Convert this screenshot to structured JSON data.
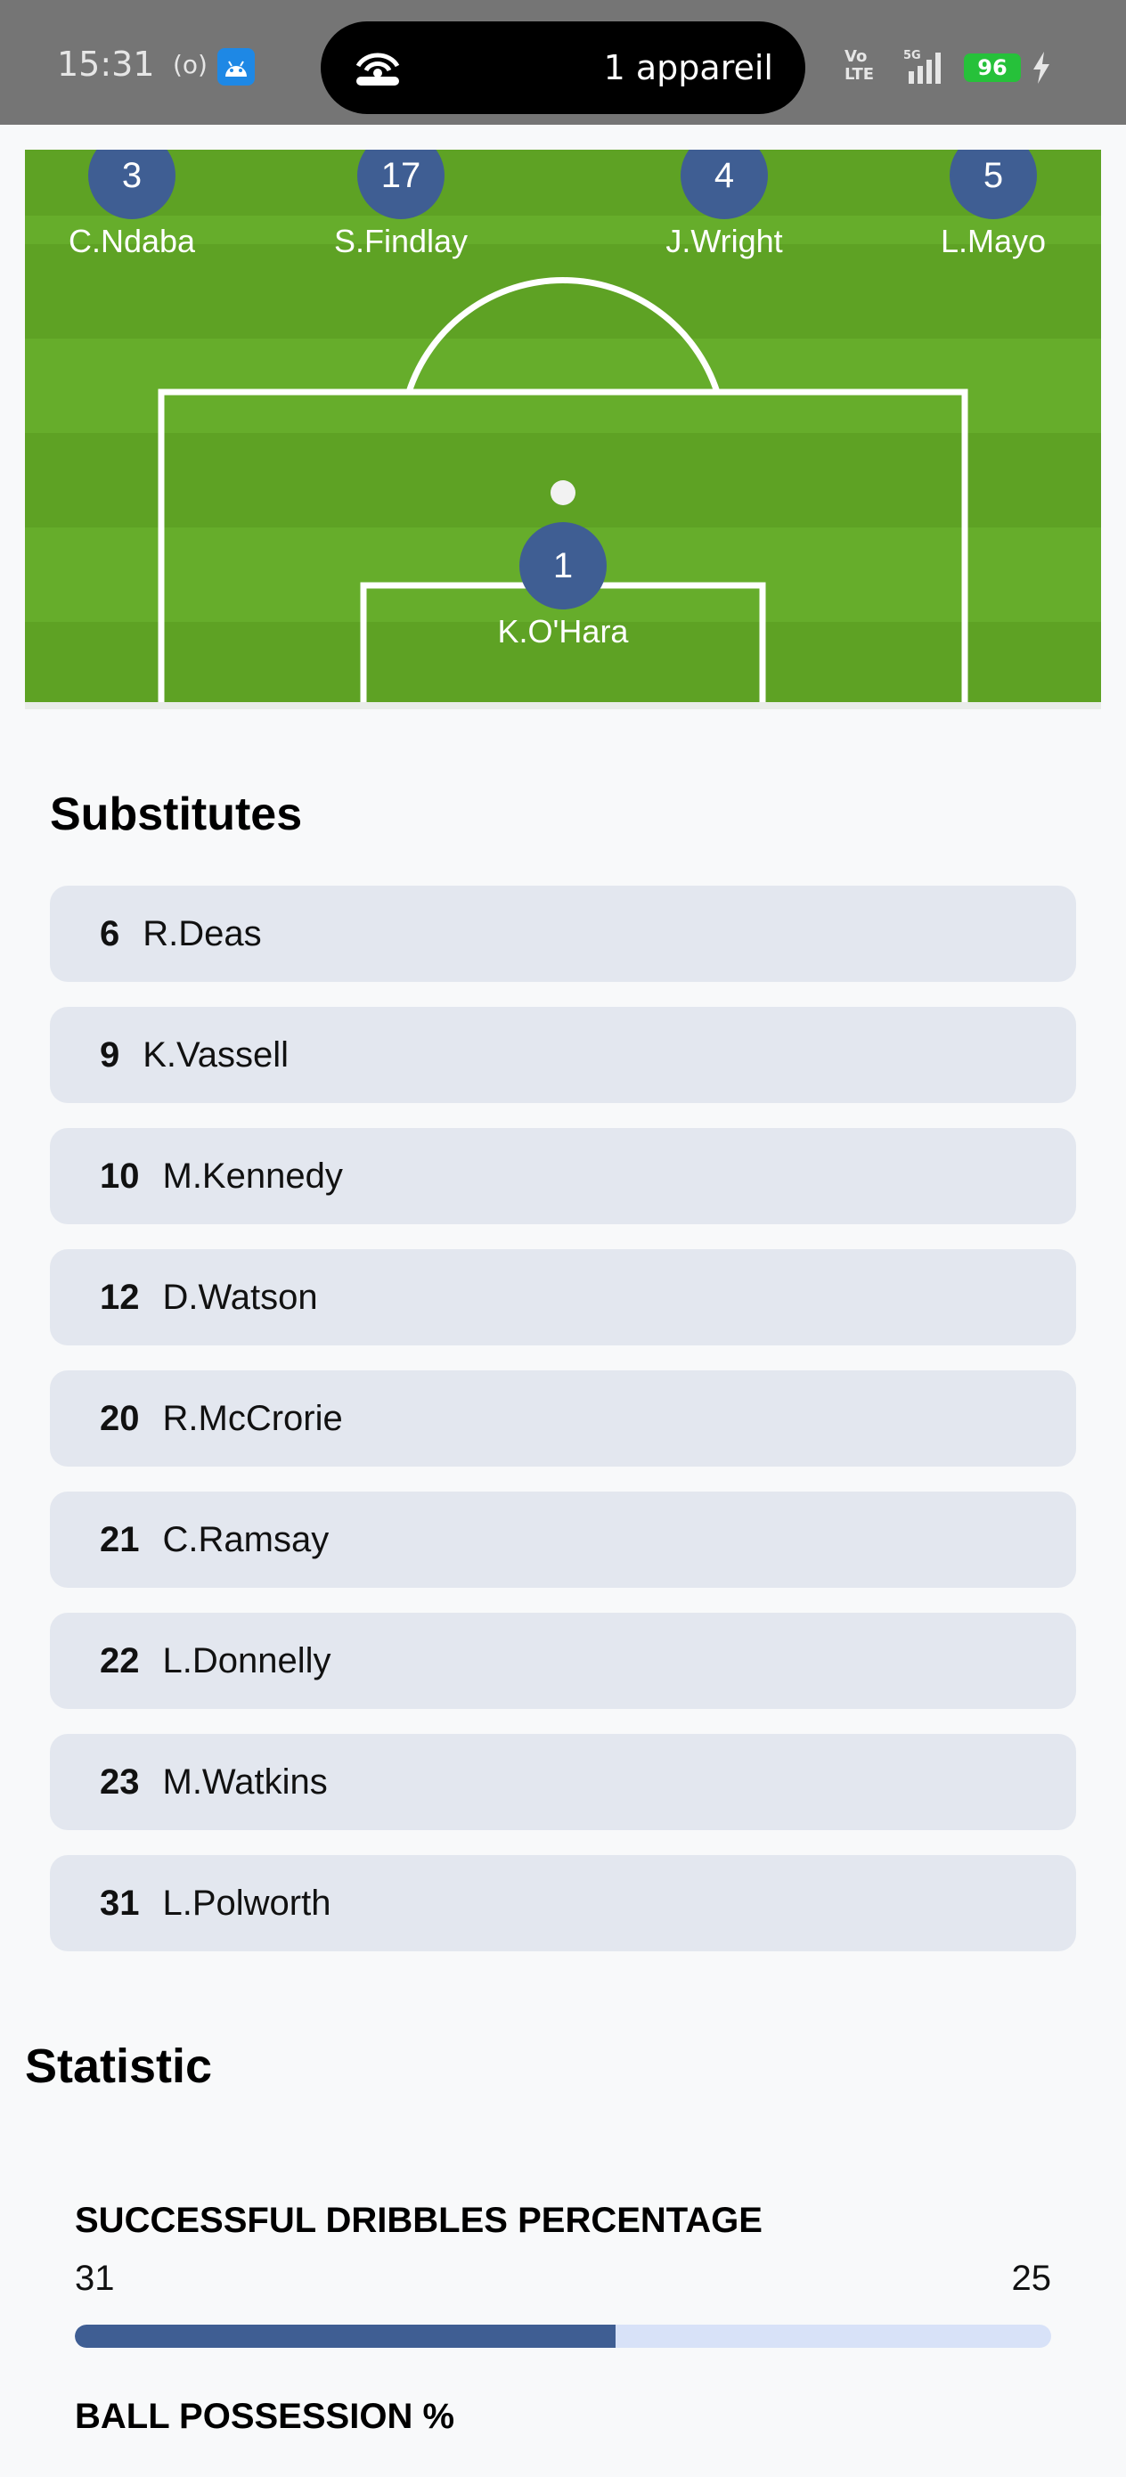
{
  "status_bar": {
    "time": "15:31",
    "radio_glyph": "(o)",
    "hotspot_text": "1 appareil",
    "network_top": "Vo",
    "network_bottom": "LTE",
    "battery": "96",
    "icons": [
      "radio-icon",
      "android-icon",
      "hotspot-icon",
      "signal-5g-icon",
      "battery-icon",
      "charging-bolt-icon"
    ]
  },
  "pitch": {
    "players_top": [
      {
        "number": "3",
        "name": "C.Ndaba"
      },
      {
        "number": "17",
        "name": "S.Findlay"
      },
      {
        "number": "4",
        "name": "J.Wright"
      },
      {
        "number": "5",
        "name": "L.Mayo"
      }
    ],
    "goalkeeper": {
      "number": "1",
      "name": "K.O'Hara"
    }
  },
  "substitutes": {
    "title": "Substitutes",
    "items": [
      {
        "number": "6",
        "name": "R.Deas"
      },
      {
        "number": "9",
        "name": "K.Vassell"
      },
      {
        "number": "10",
        "name": "M.Kennedy"
      },
      {
        "number": "12",
        "name": "D.Watson"
      },
      {
        "number": "20",
        "name": "R.McCrorie"
      },
      {
        "number": "21",
        "name": "C.Ramsay"
      },
      {
        "number": "22",
        "name": "L.Donnelly"
      },
      {
        "number": "23",
        "name": "M.Watkins"
      },
      {
        "number": "31",
        "name": "L.Polworth"
      }
    ]
  },
  "statistic": {
    "title": "Statistic",
    "items": [
      {
        "label": "SUCCESSFUL DRIBBLES PERCENTAGE",
        "home": "31",
        "away": "25",
        "home_share": 0.554
      },
      {
        "label": "BALL POSSESSION %"
      }
    ]
  },
  "colors": {
    "team_accent": "#3f5e93",
    "bar_track": "#d8e2f8",
    "pitch_light": "#66ad2b",
    "pitch_dark": "#5ea224",
    "sub_item_bg": "#e3e7ef"
  }
}
